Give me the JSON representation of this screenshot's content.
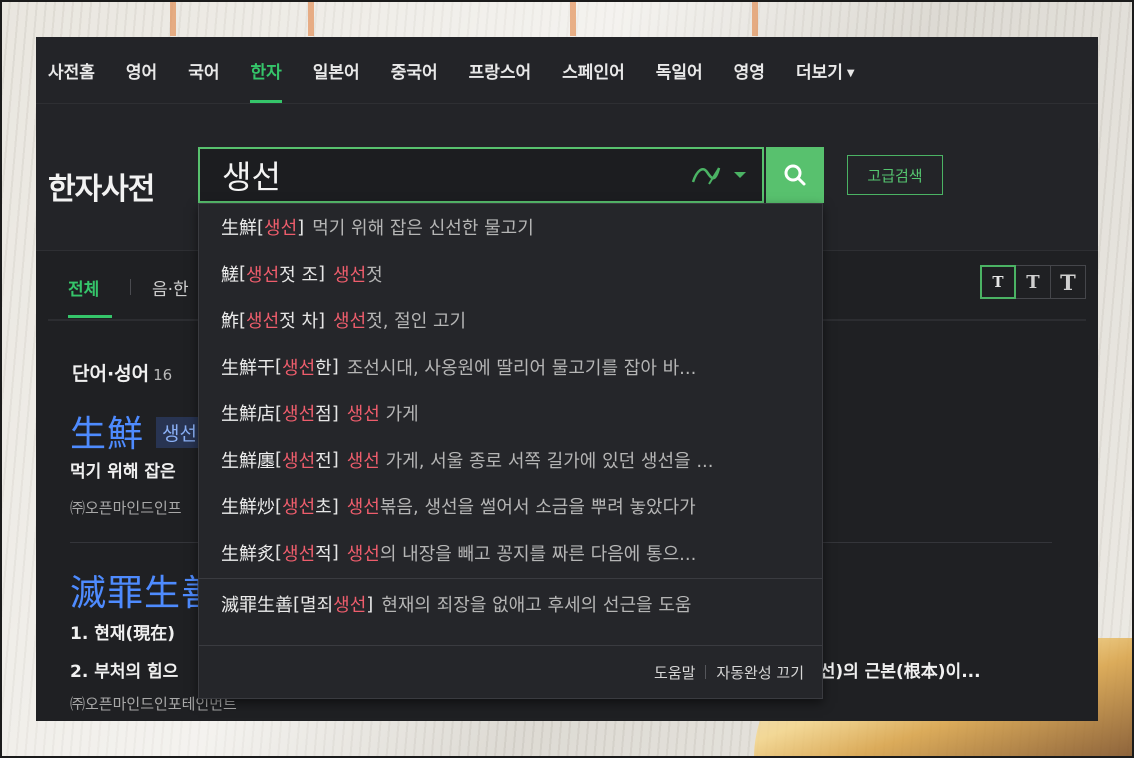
{
  "nav": {
    "items": [
      "사전홈",
      "영어",
      "국어",
      "한자",
      "일본어",
      "중국어",
      "프랑스어",
      "스페인어",
      "독일어",
      "영영",
      "더보기"
    ],
    "active": "한자"
  },
  "header": {
    "title": "한자사전",
    "search_value": "생선",
    "advanced_search": "고급검색"
  },
  "tabs": {
    "all": "전체",
    "sound": "음·한"
  },
  "font_sizes": [
    "T",
    "T",
    "T"
  ],
  "results": {
    "section_title": "단어·성어",
    "section_count": "16",
    "entry1": {
      "word": "生鮮",
      "reading": "생선",
      "definition": "먹기 위해 잡은",
      "source": "㈜오픈마인드인프"
    },
    "entry2": {
      "word": "滅罪生善",
      "def1": "1. 현재(現在)",
      "def2": "2. 부처의 힘으",
      "def2_tail": "(선)의 근본(根本)이...",
      "source": "㈜오픈마인드인포테인먼트"
    }
  },
  "suggestions": [
    {
      "hanja": "生鮮",
      "pre": "",
      "red": "생선",
      "post": "",
      "meaning_red": "",
      "meaning": "먹기 위해 잡은 신선한 물고기"
    },
    {
      "hanja": "䱹",
      "pre": "",
      "red": "생선",
      "post": "젓 조",
      "meaning_red": "생선",
      "meaning": "젓"
    },
    {
      "hanja": "鮓",
      "pre": "",
      "red": "생선",
      "post": "젓 차",
      "meaning_red": "생선",
      "meaning": "젓, 절인 고기"
    },
    {
      "hanja": "生鮮干",
      "pre": "",
      "red": "생선",
      "post": "한",
      "meaning_red": "",
      "meaning": "조선시대, 사옹원에 딸리어 물고기를 잡아 바..."
    },
    {
      "hanja": "生鮮店",
      "pre": "",
      "red": "생선",
      "post": "점",
      "meaning_red": "생선",
      "meaning": " 가게"
    },
    {
      "hanja": "生鮮廛",
      "pre": "",
      "red": "생선",
      "post": "전",
      "meaning_red": "생선",
      "meaning": " 가게, 서울 종로 서쪽 길가에 있던 생선을 ..."
    },
    {
      "hanja": "生鮮炒",
      "pre": "",
      "red": "생선",
      "post": "초",
      "meaning_red": "생선",
      "meaning": "볶음, 생선을 썰어서 소금을 뿌려 놓았다가"
    },
    {
      "hanja": "生鮮炙",
      "pre": "",
      "red": "생선",
      "post": "적",
      "meaning_red": "생선",
      "meaning": "의 내장을 빼고 꽁지를 짜른 다음에 통으..."
    }
  ],
  "suggestion_last": {
    "hanja": "滅罪生善",
    "pre": "멸죄",
    "red": "생선",
    "post": "",
    "meaning_red": "",
    "meaning": "현재의 죄장을 없애고 후세의 선근을 도움"
  },
  "suggest_footer": {
    "help": "도움말",
    "autocomplete_off": "자동완성 끄기"
  },
  "colors": {
    "accent": "#35c56a",
    "highlight": "#ee5d6c",
    "link_blue": "#4e8bff"
  }
}
